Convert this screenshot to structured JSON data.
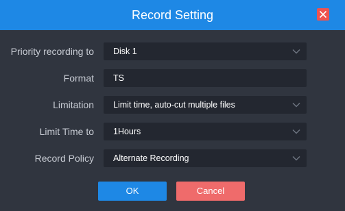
{
  "dialog": {
    "title": "Record Setting"
  },
  "fields": [
    {
      "label": "Priority recording to",
      "value": "Disk 1",
      "has_dropdown": true
    },
    {
      "label": "Format",
      "value": "TS",
      "has_dropdown": false
    },
    {
      "label": "Limitation",
      "value": "Limit time, auto-cut multiple files",
      "has_dropdown": true
    },
    {
      "label": "Limit Time to",
      "value": "1Hours",
      "has_dropdown": true
    },
    {
      "label": "Record Policy",
      "value": "Alternate Recording",
      "has_dropdown": true
    }
  ],
  "buttons": {
    "ok_label": "OK",
    "cancel_label": "Cancel"
  },
  "colors": {
    "accent": "#1e88e5",
    "close": "#ef5350",
    "cancel": "#ef6b6b"
  },
  "icons": {
    "close": "close-icon",
    "dropdown": "chevron-down-icon"
  }
}
